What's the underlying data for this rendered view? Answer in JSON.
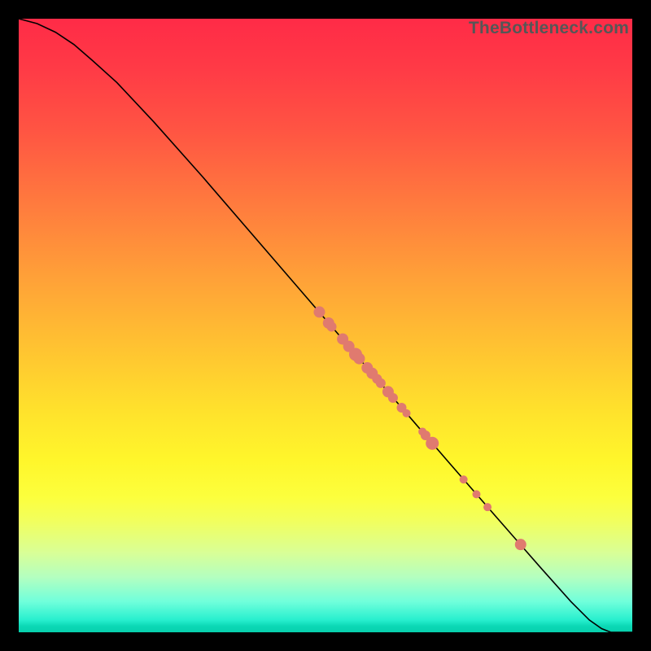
{
  "watermark": "TheBottleneck.com",
  "chart_data": {
    "type": "line",
    "title": "",
    "xlabel": "",
    "ylabel": "",
    "xlim": [
      0,
      100
    ],
    "ylim": [
      0,
      100
    ],
    "grid": false,
    "legend": false,
    "x": [
      0,
      3,
      6,
      9,
      12,
      16,
      22,
      30,
      40,
      50,
      60,
      70,
      78,
      85,
      90,
      93,
      95,
      96.5,
      100
    ],
    "y": [
      100,
      99.2,
      97.8,
      95.8,
      93.2,
      89.6,
      83.2,
      74.2,
      62.6,
      51.0,
      39.4,
      27.8,
      18.6,
      10.6,
      5.0,
      2.0,
      0.6,
      0,
      0
    ],
    "points": [
      {
        "x": 49.0,
        "y": 52.2,
        "r": 7
      },
      {
        "x": 50.5,
        "y": 50.4,
        "r": 7
      },
      {
        "x": 51.0,
        "y": 49.8,
        "r": 6
      },
      {
        "x": 52.8,
        "y": 47.8,
        "r": 7
      },
      {
        "x": 53.8,
        "y": 46.6,
        "r": 7
      },
      {
        "x": 54.9,
        "y": 45.3,
        "r": 8
      },
      {
        "x": 55.5,
        "y": 44.6,
        "r": 7
      },
      {
        "x": 56.8,
        "y": 43.1,
        "r": 7
      },
      {
        "x": 57.6,
        "y": 42.2,
        "r": 7
      },
      {
        "x": 58.4,
        "y": 41.3,
        "r": 6
      },
      {
        "x": 59.0,
        "y": 40.6,
        "r": 6
      },
      {
        "x": 60.2,
        "y": 39.2,
        "r": 7
      },
      {
        "x": 61.0,
        "y": 38.2,
        "r": 6
      },
      {
        "x": 62.4,
        "y": 36.6,
        "r": 6
      },
      {
        "x": 63.2,
        "y": 35.7,
        "r": 5
      },
      {
        "x": 65.8,
        "y": 32.7,
        "r": 5
      },
      {
        "x": 66.3,
        "y": 32.1,
        "r": 6
      },
      {
        "x": 67.4,
        "y": 30.8,
        "r": 8
      },
      {
        "x": 72.5,
        "y": 24.9,
        "r": 5
      },
      {
        "x": 74.6,
        "y": 22.5,
        "r": 5
      },
      {
        "x": 76.4,
        "y": 20.4,
        "r": 5
      },
      {
        "x": 81.8,
        "y": 14.3,
        "r": 7
      }
    ]
  },
  "gradient_colors": {
    "top": "#ff2b47",
    "mid": "#ffe22c",
    "bottom": "#07d0ad"
  }
}
